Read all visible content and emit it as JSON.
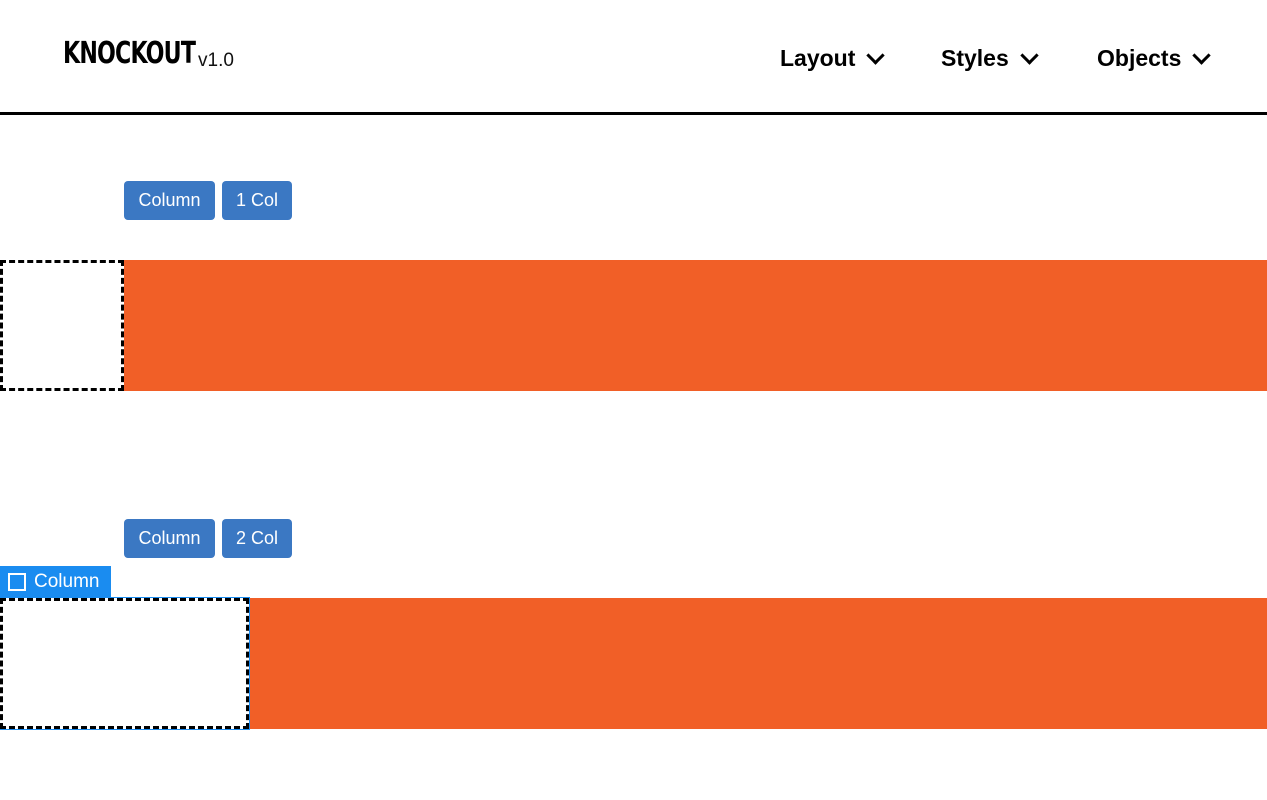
{
  "header": {
    "logo": "KNOCKOUT",
    "version": "v1.0",
    "nav": [
      {
        "label": "Layout"
      },
      {
        "label": "Styles"
      },
      {
        "label": "Objects"
      }
    ]
  },
  "sections": [
    {
      "buttons": [
        "Column",
        "1 Col"
      ]
    },
    {
      "buttons": [
        "Column",
        "2 Col"
      ],
      "selected_tag": "Column"
    }
  ],
  "colors": {
    "band": "#f15f27",
    "button": "#3b78c3",
    "selection": "#1a8cf0"
  }
}
